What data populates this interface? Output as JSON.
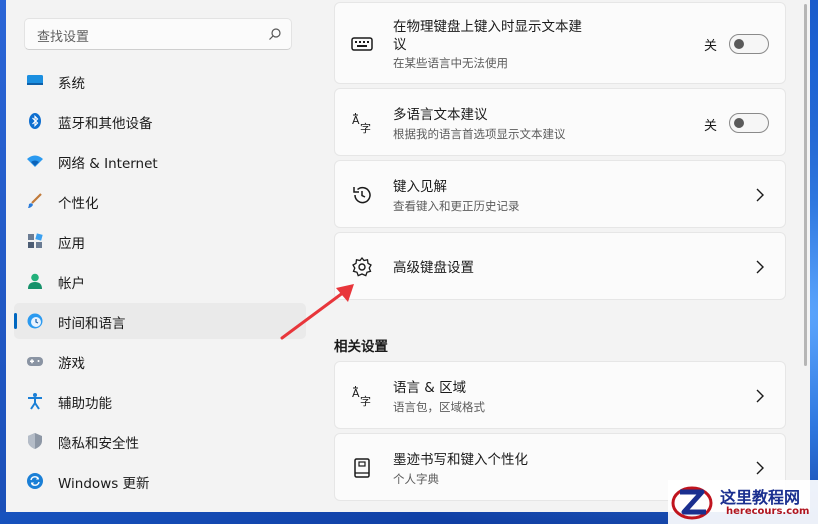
{
  "search": {
    "placeholder": "查找设置"
  },
  "sidebar": {
    "items": [
      {
        "label": "系统",
        "icon": "display-icon",
        "active": false
      },
      {
        "label": "蓝牙和其他设备",
        "icon": "bluetooth-icon",
        "active": false
      },
      {
        "label": "网络 & Internet",
        "icon": "wifi-icon",
        "active": false
      },
      {
        "label": "个性化",
        "icon": "brush-icon",
        "active": false
      },
      {
        "label": "应用",
        "icon": "apps-icon",
        "active": false
      },
      {
        "label": "帐户",
        "icon": "account-icon",
        "active": false
      },
      {
        "label": "时间和语言",
        "icon": "time-language-icon",
        "active": true
      },
      {
        "label": "游戏",
        "icon": "gamepad-icon",
        "active": false
      },
      {
        "label": "辅助功能",
        "icon": "accessibility-icon",
        "active": false
      },
      {
        "label": "隐私和安全性",
        "icon": "shield-icon",
        "active": false
      },
      {
        "label": "Windows 更新",
        "icon": "update-icon",
        "active": false
      }
    ]
  },
  "main": {
    "cards": [
      {
        "title_line1": "在物理键盘上键入时显示文本建",
        "title_line2": "议",
        "subtitle": "在某些语言中无法使用",
        "toggle_label": "关",
        "toggle_on": false,
        "icon": "keyboard-icon"
      },
      {
        "title": "多语言文本建议",
        "subtitle": "根据我的语言首选项显示文本建议",
        "toggle_label": "关",
        "toggle_on": false,
        "icon": "language-icon"
      },
      {
        "title": "键入见解",
        "subtitle": "查看键入和更正历史记录",
        "icon": "history-icon"
      },
      {
        "title": "高级键盘设置",
        "icon": "gear-icon"
      }
    ],
    "related_title": "相关设置",
    "related_cards": [
      {
        "title": "语言 & 区域",
        "subtitle": "语言包，区域格式",
        "icon": "language-icon"
      },
      {
        "title": "墨迹书写和键入个性化",
        "subtitle": "个人字典",
        "icon": "notebook-icon"
      }
    ]
  },
  "watermark": {
    "title": "这里教程网",
    "url": "herecours.com"
  },
  "colors": {
    "accent": "#0067c0",
    "annotation_arrow": "#e8363b"
  }
}
